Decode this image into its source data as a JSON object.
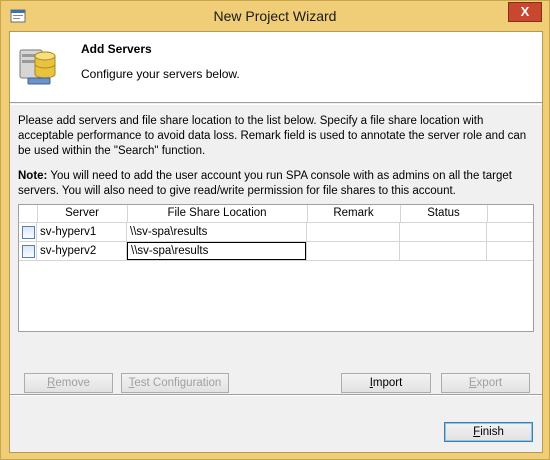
{
  "window": {
    "title": "New Project Wizard",
    "close_label": "X"
  },
  "header": {
    "title": "Add Servers",
    "subtitle": "Configure your servers below."
  },
  "description": "Please add servers and file share location to the list below. Specify a file share location with acceptable performance to avoid data loss. Remark field is used to annotate the server role and can be used within the \"Search\" function.",
  "note": {
    "label": "Note:",
    "text": " You will need to add the user account you run SPA console with as admins on all the target servers. You will also need to give read/write permission for file shares to this account."
  },
  "table": {
    "columns": [
      "Server",
      "File Share Location",
      "Remark",
      "Status"
    ],
    "rows": [
      {
        "server": "sv-hyperv1",
        "share": "\\\\sv-spa\\results",
        "remark": "",
        "status": "",
        "checked": false
      },
      {
        "server": "sv-hyperv2",
        "share": "\\\\sv-spa\\results",
        "remark": "",
        "status": "",
        "checked": false
      }
    ]
  },
  "buttons": {
    "remove": {
      "first": "R",
      "rest": "emove"
    },
    "test": {
      "first": "T",
      "rest": "est Configuration"
    },
    "import": {
      "first": "I",
      "rest": "mport"
    },
    "export": {
      "first": "E",
      "rest": "xport"
    },
    "finish": {
      "first": "F",
      "rest": "inish"
    }
  }
}
